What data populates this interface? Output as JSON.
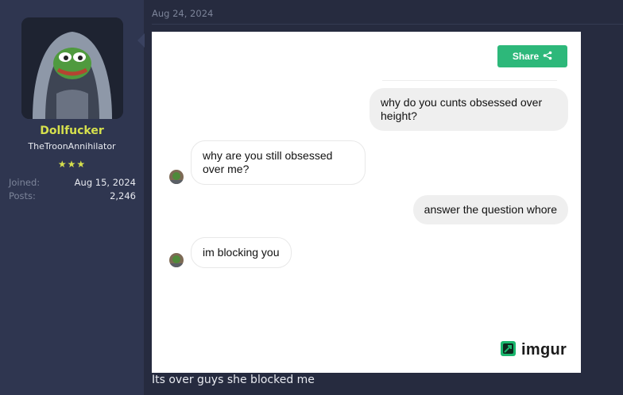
{
  "post": {
    "date": "Aug 24, 2024",
    "caption": "Its over guys she blocked me"
  },
  "user": {
    "name": "Dollfucker",
    "title": "TheTroonAnnihilator",
    "stars": "★★★",
    "joined_label": "Joined:",
    "joined_value": "Aug 15, 2024",
    "posts_label": "Posts:",
    "posts_value": "2,246"
  },
  "screenshot": {
    "share_label": "Share",
    "messages": [
      {
        "from": "me",
        "text": "why do you cunts obsessed over height?"
      },
      {
        "from": "them",
        "text": "why are you still obsessed over me?"
      },
      {
        "from": "me",
        "text": "answer the question whore"
      },
      {
        "from": "them",
        "text": "im blocking you"
      }
    ],
    "watermark": "imgur"
  },
  "colors": {
    "background": "#262b3f",
    "sidebar": "#2f3650",
    "username": "#d6e04d",
    "share_green": "#2db87a"
  },
  "icons": [
    "avatar",
    "share-icon",
    "contact-avatar-icon",
    "imgur-logo-icon"
  ]
}
